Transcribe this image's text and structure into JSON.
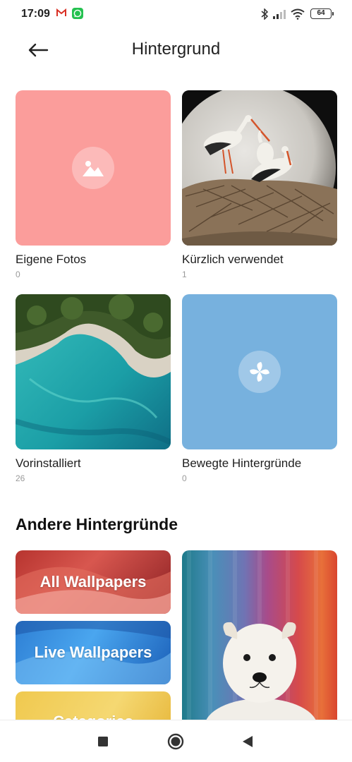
{
  "status_bar": {
    "time": "17:09",
    "battery": "64",
    "icons": [
      "gmail-icon",
      "whatsapp-icon",
      "bluetooth-icon",
      "signal-icon",
      "wifi-icon",
      "battery-icon"
    ]
  },
  "header": {
    "title": "Hintergrund",
    "back_icon": "arrow-left-icon"
  },
  "categories": [
    {
      "label": "Eigene Fotos",
      "count": "0",
      "icon": "image-icon",
      "color": "#fb9d9b"
    },
    {
      "label": "Kürzlich verwendet",
      "count": "1",
      "image": "storks-on-nest"
    },
    {
      "label": "Vorinstalliert",
      "count": "26",
      "image": "aerial-coastline"
    },
    {
      "label": "Bewegte Hintergründe",
      "count": "0",
      "icon": "pinwheel-icon",
      "color": "#77b1de"
    }
  ],
  "other_section": {
    "title": "Andere Hintergründe",
    "banners": [
      {
        "label": "All Wallpapers"
      },
      {
        "label": "Live Wallpapers"
      },
      {
        "label": "Categories"
      }
    ],
    "featured_image": "white-puppy-on-rainbow"
  },
  "nav": {
    "icons": [
      "recents-square-icon",
      "home-circle-icon",
      "back-triangle-icon"
    ]
  }
}
